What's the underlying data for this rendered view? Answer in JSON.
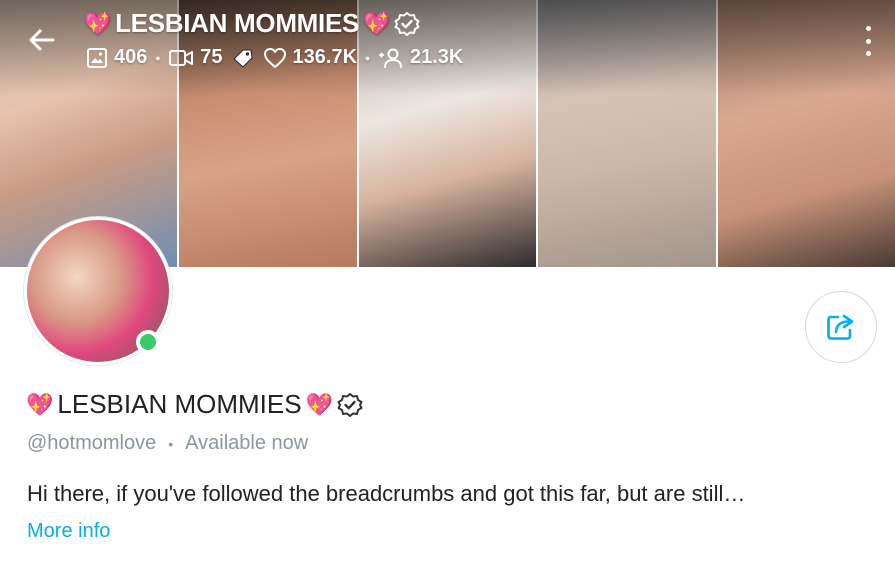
{
  "header": {
    "title": "LESBIAN MOMMIES",
    "heart_glyph": "💖",
    "stats": {
      "photos": "406",
      "videos": "75",
      "likes": "136.7K",
      "fans": "21.3K"
    },
    "icons": [
      "arrow-left-icon",
      "image-icon",
      "video-icon",
      "tag-icon",
      "heart-icon",
      "fans-icon",
      "verified-icon",
      "more-vertical-icon"
    ]
  },
  "profile": {
    "name": "LESBIAN MOMMIES",
    "handle": "@hotmomlove",
    "status": "Available now",
    "bio": "Hi there, if you've followed the breadcrumbs and got this far, but are still…",
    "more_info_label": "More info",
    "online": true
  },
  "colors": {
    "accent": "#00aff0",
    "online": "#3cc96b",
    "muted_text": "#8a96a3",
    "heart": "#c0182a"
  }
}
